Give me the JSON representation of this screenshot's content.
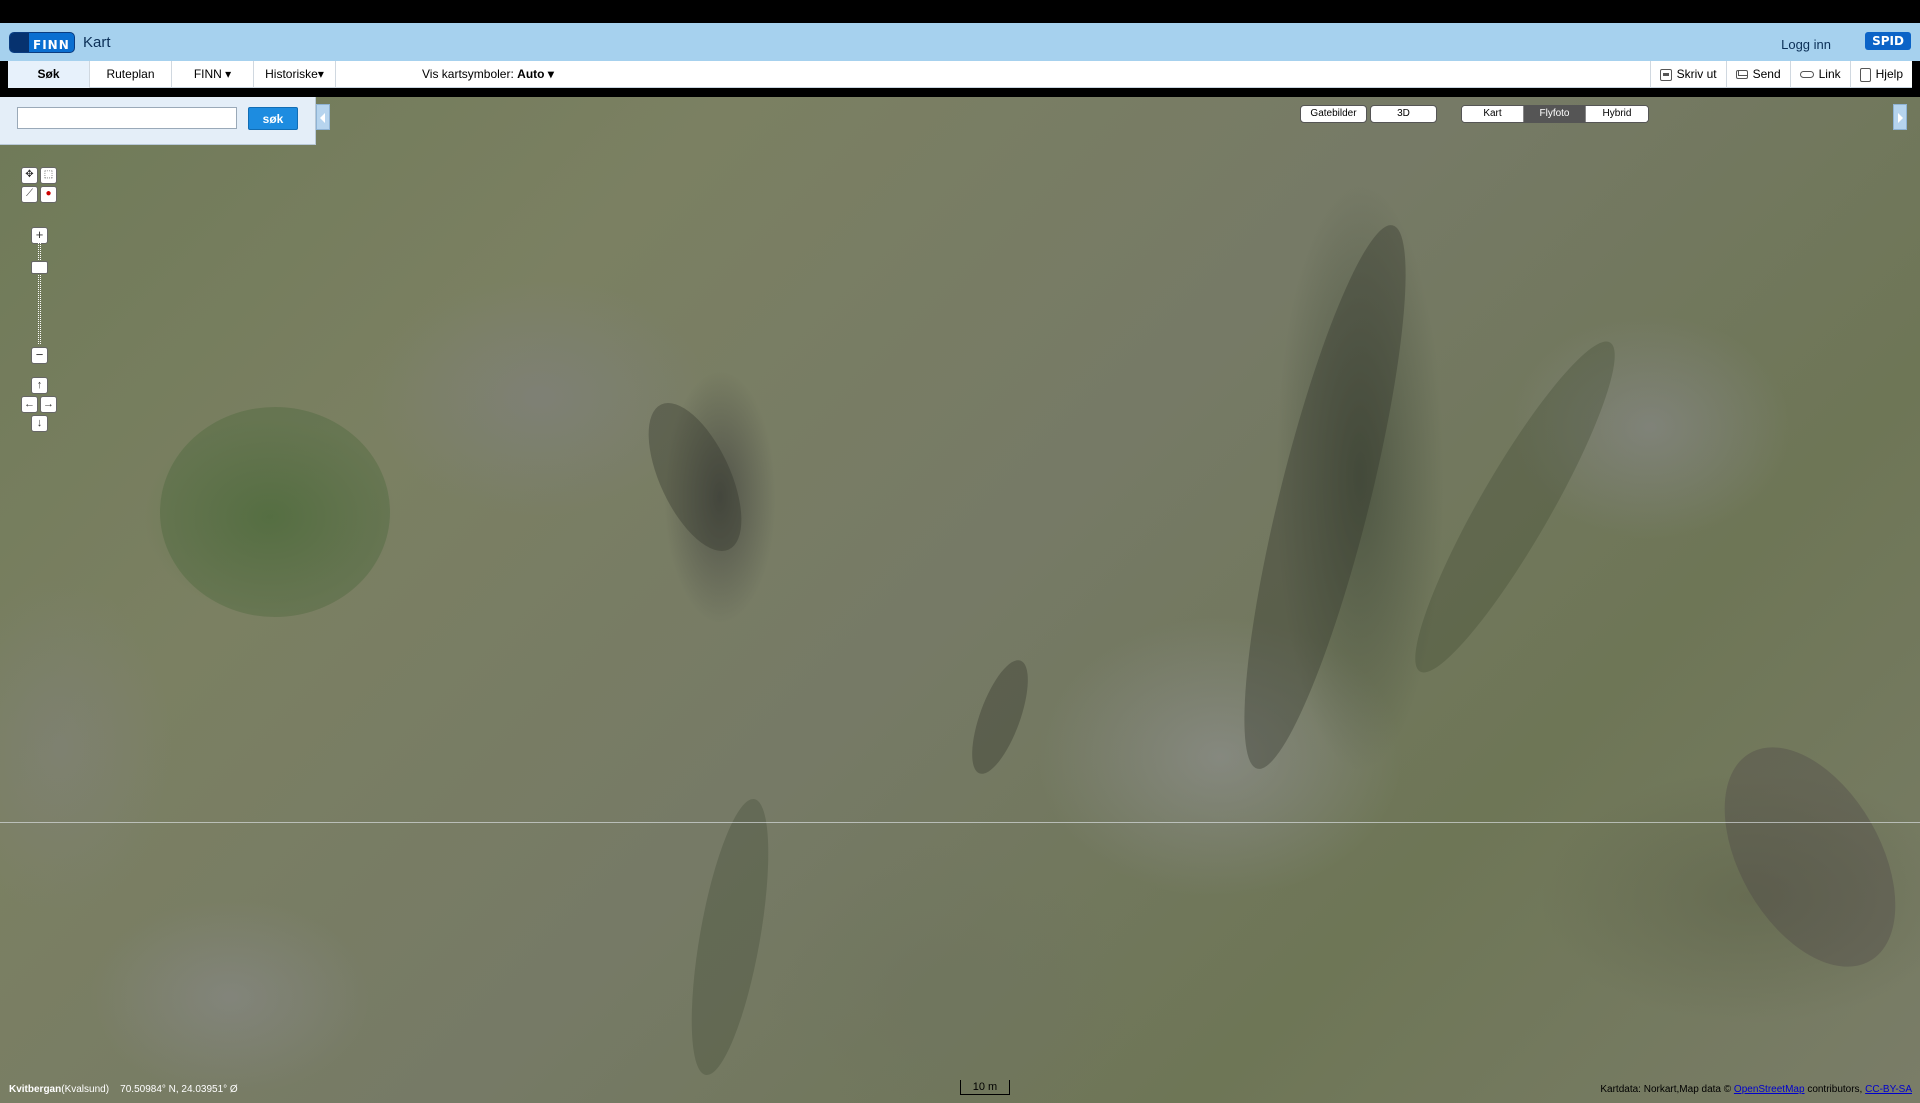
{
  "header": {
    "logo_text": "FINN",
    "app_title": "Kart",
    "login_label": "Logg inn",
    "spid_label": "SPID"
  },
  "nav": {
    "tabs": [
      {
        "label": "Søk",
        "active": true
      },
      {
        "label": "Ruteplan",
        "active": false
      },
      {
        "label": "FINN ▾",
        "active": false
      },
      {
        "label": "Historiske▾",
        "active": false
      }
    ],
    "vis_prefix": "Vis kartsymboler:",
    "vis_value": "Auto ▾",
    "right_tools": [
      {
        "label": "Skriv ut",
        "icon": "printer-icon"
      },
      {
        "label": "Send",
        "icon": "mail-icon"
      },
      {
        "label": "Link",
        "icon": "link-icon"
      },
      {
        "label": "Hjelp",
        "icon": "help-icon"
      }
    ]
  },
  "search": {
    "value": "",
    "placeholder": "",
    "button_label": "søk"
  },
  "map_buttons": {
    "gatebilder": "Gatebilder",
    "three_d": "3D",
    "kart": "Kart",
    "flyfoto": "Flyfoto",
    "hybrid": "Hybrid",
    "active": "Flyfoto"
  },
  "footer": {
    "place_name": "Kvitbergan",
    "place_region": "(Kvalsund)",
    "coordinates": "70.50984° N, 24.03951° Ø",
    "scale_label": "10 m",
    "credits_prefix": "Kartdata: Norkart,Map data ©",
    "credits_osm": "OpenStreetMap",
    "credits_mid": "contributors,",
    "credits_license": "CC-BY-SA"
  },
  "colors": {
    "header_bg": "#a6d1ee",
    "search_button": "#1d8ce0",
    "active_map_button": "#555555"
  }
}
